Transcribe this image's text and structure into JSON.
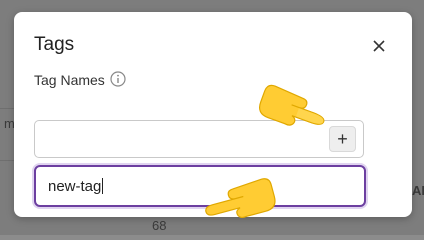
{
  "background": {
    "left_fragment": "m",
    "right_fragment": "AR",
    "bottom_number": "68"
  },
  "modal": {
    "title": "Tags",
    "field_label": "Tag Names",
    "tag_input_value": "",
    "add_button_label": "+",
    "new_tag_value": "new-tag"
  },
  "icons": {
    "close": "close-icon",
    "info": "info-icon",
    "hand": "pointing-hand-icon"
  },
  "colors": {
    "focus_border": "#6c3fa0",
    "hand_fill": "#ffcc33"
  }
}
